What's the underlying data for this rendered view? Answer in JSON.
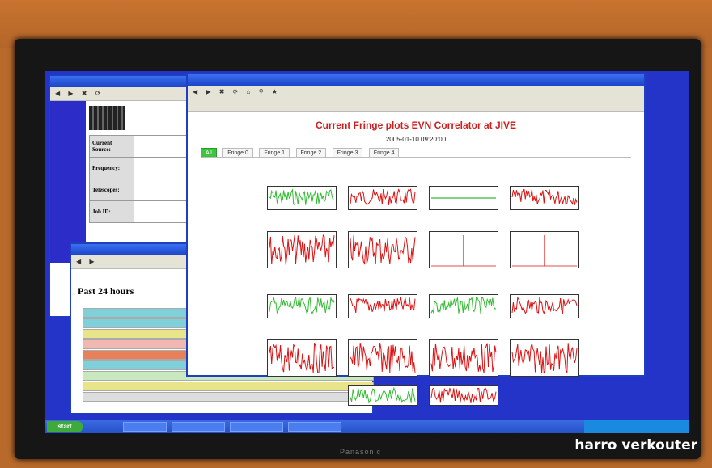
{
  "main": {
    "title": "Current Fringe plots EVN Correlator at JIVE",
    "date": "2005-01-10 09:20:00",
    "tabs": [
      "All",
      "Fringe 0",
      "Fringe 1",
      "Fringe 2",
      "Fringe 3",
      "Fringe 4"
    ]
  },
  "left_window": {
    "heading": "Past 24 hours"
  },
  "back_window": {
    "labels": [
      "Current Source:",
      "Frequency:",
      "Telescopes:",
      "Job ID:"
    ]
  },
  "taskbar": {
    "start_label": "start"
  },
  "signature": "harro verkouter",
  "colors": {
    "green_trace": "#33bb33",
    "red_trace": "#dd1111",
    "title_red": "#cc2020",
    "desktop": "#2434c8"
  }
}
